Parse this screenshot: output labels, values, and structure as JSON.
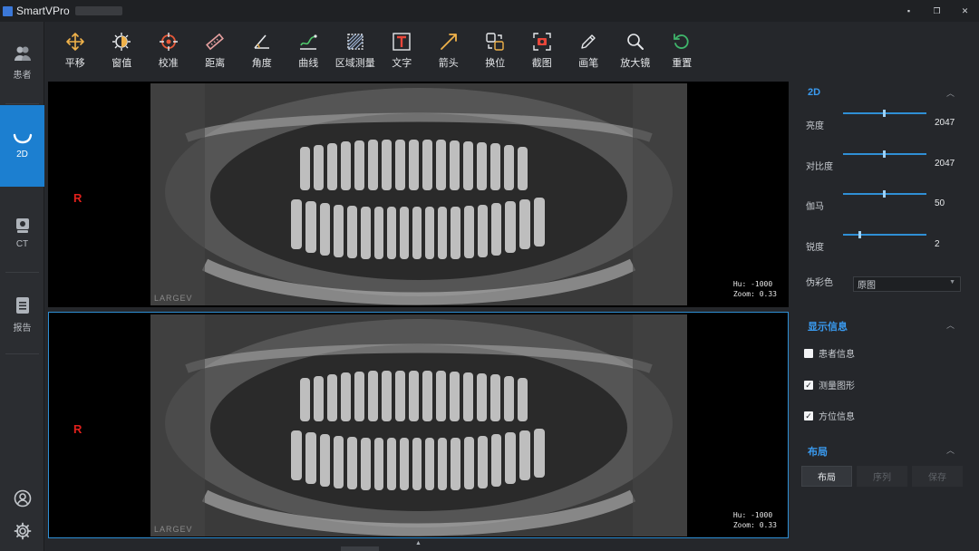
{
  "app": {
    "title": "SmartVPro"
  },
  "window": {
    "minimize": "▪",
    "restore": "❐",
    "close": "✕"
  },
  "leftnav": {
    "items": [
      {
        "label": "患者",
        "icon": "patients-icon"
      },
      {
        "label": "2D",
        "icon": "tooth-arch-icon",
        "active": true
      },
      {
        "label": "CT",
        "icon": "ct-scanner-icon"
      },
      {
        "label": "报告",
        "icon": "report-icon"
      }
    ],
    "bottom": [
      {
        "icon": "user-icon"
      },
      {
        "icon": "settings-gear-icon"
      }
    ]
  },
  "toolbar": {
    "tools": [
      {
        "label": "平移",
        "icon": "move-icon"
      },
      {
        "label": "窗值",
        "icon": "window-level-icon"
      },
      {
        "label": "校准",
        "icon": "calibrate-icon"
      },
      {
        "label": "距离",
        "icon": "ruler-icon"
      },
      {
        "label": "角度",
        "icon": "angle-icon"
      },
      {
        "label": "曲线",
        "icon": "curve-icon"
      },
      {
        "label": "区域测量",
        "icon": "area-measure-icon"
      },
      {
        "label": "文字",
        "icon": "text-icon"
      },
      {
        "label": "箭头",
        "icon": "arrow-icon"
      },
      {
        "label": "换位",
        "icon": "swap-icon"
      },
      {
        "label": "截图",
        "icon": "screenshot-icon"
      },
      {
        "label": "画笔",
        "icon": "pen-icon"
      },
      {
        "label": "放大镜",
        "icon": "magnifier-icon"
      },
      {
        "label": "重置",
        "icon": "reset-icon"
      }
    ]
  },
  "viewer": {
    "panels": [
      {
        "orientation": "R",
        "hu": "Hu: -1000",
        "zoom": "Zoom: 0.33",
        "brand": "LARGEV"
      },
      {
        "orientation": "R",
        "hu": "Hu: -1000",
        "zoom": "Zoom: 0.33",
        "brand": "LARGEV",
        "selected": true
      }
    ]
  },
  "rightpanel": {
    "section_2d": {
      "title": "2D",
      "controls": [
        {
          "label": "亮度",
          "value": "2047",
          "level": 0.5
        },
        {
          "label": "对比度",
          "value": "2047",
          "level": 0.5
        },
        {
          "label": "伽马",
          "value": "50",
          "level": 0.5
        },
        {
          "label": "锐度",
          "value": "2",
          "level": 0.2
        }
      ],
      "pseudocolor": {
        "label": "伪彩色",
        "value": "原图"
      }
    },
    "section_display": {
      "title": "显示信息",
      "checks": [
        {
          "label": "患者信息",
          "checked": false
        },
        {
          "label": "测量图形",
          "checked": true
        },
        {
          "label": "方位信息",
          "checked": true
        }
      ]
    },
    "section_layout": {
      "title": "布局",
      "buttons": [
        "布局",
        "序列",
        "保存"
      ]
    }
  },
  "colors": {
    "accent": "#1c7fd0",
    "orientation_marker": "#e0201c",
    "highlight": "#3a9bf0"
  }
}
